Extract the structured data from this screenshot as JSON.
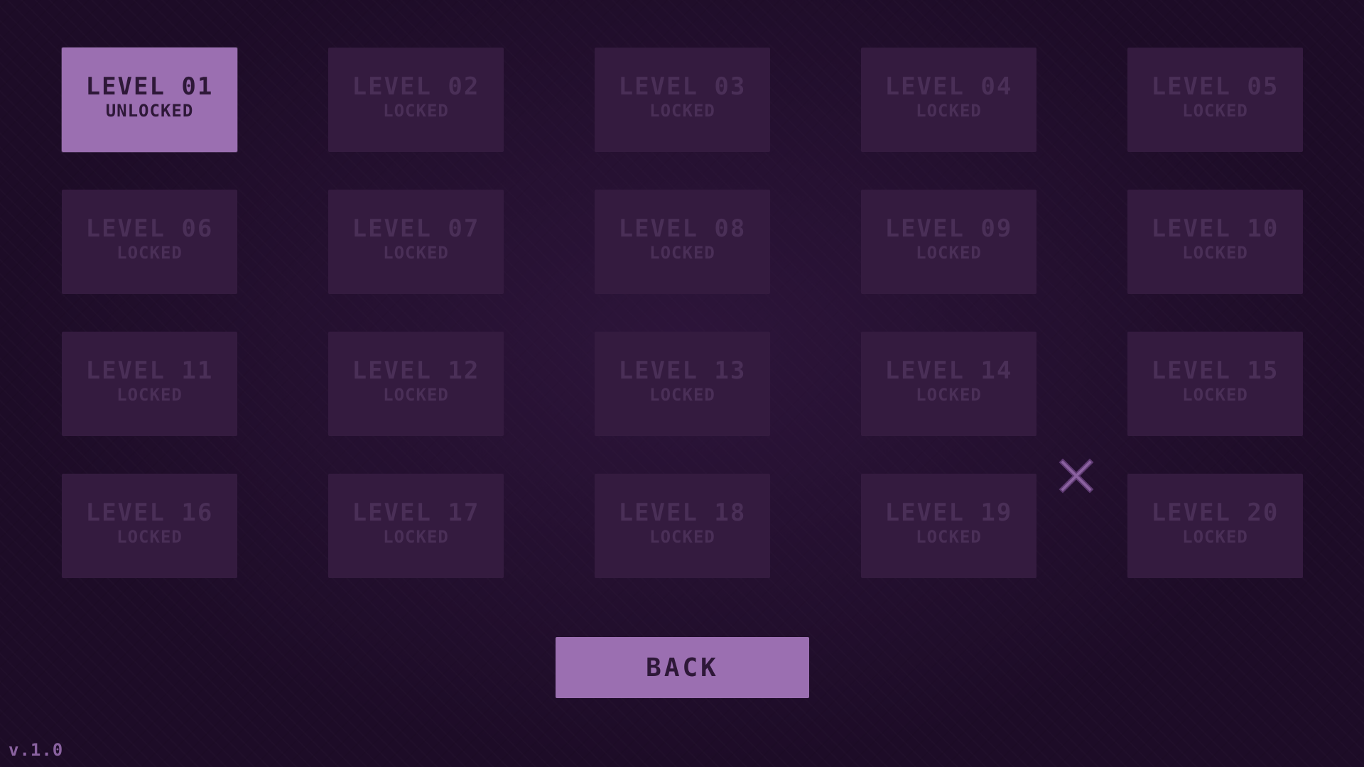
{
  "levels": [
    {
      "title": "LEVEL 01",
      "status": "UNLOCKED",
      "unlocked": true
    },
    {
      "title": "LEVEL 02",
      "status": "LOCKED",
      "unlocked": false
    },
    {
      "title": "LEVEL 03",
      "status": "LOCKED",
      "unlocked": false
    },
    {
      "title": "LEVEL 04",
      "status": "LOCKED",
      "unlocked": false
    },
    {
      "title": "LEVEL 05",
      "status": "LOCKED",
      "unlocked": false
    },
    {
      "title": "LEVEL 06",
      "status": "LOCKED",
      "unlocked": false
    },
    {
      "title": "LEVEL 07",
      "status": "LOCKED",
      "unlocked": false
    },
    {
      "title": "LEVEL 08",
      "status": "LOCKED",
      "unlocked": false
    },
    {
      "title": "LEVEL 09",
      "status": "LOCKED",
      "unlocked": false
    },
    {
      "title": "LEVEL 10",
      "status": "LOCKED",
      "unlocked": false
    },
    {
      "title": "LEVEL 11",
      "status": "LOCKED",
      "unlocked": false
    },
    {
      "title": "LEVEL 12",
      "status": "LOCKED",
      "unlocked": false
    },
    {
      "title": "LEVEL 13",
      "status": "LOCKED",
      "unlocked": false
    },
    {
      "title": "LEVEL 14",
      "status": "LOCKED",
      "unlocked": false
    },
    {
      "title": "LEVEL 15",
      "status": "LOCKED",
      "unlocked": false
    },
    {
      "title": "LEVEL 16",
      "status": "LOCKED",
      "unlocked": false
    },
    {
      "title": "LEVEL 17",
      "status": "LOCKED",
      "unlocked": false
    },
    {
      "title": "LEVEL 18",
      "status": "LOCKED",
      "unlocked": false
    },
    {
      "title": "LEVEL 19",
      "status": "LOCKED",
      "unlocked": false
    },
    {
      "title": "LEVEL 20",
      "status": "LOCKED",
      "unlocked": false
    }
  ],
  "back_button": {
    "label": "BACK"
  },
  "cursor": {
    "icon": "x-cursor-icon"
  },
  "version": "v.1.0",
  "colors": {
    "background": "#1d0c27",
    "tile_locked": "#341b3f",
    "tile_locked_text": "#4a2f57",
    "tile_unlocked": "#9b6fb1",
    "tile_unlocked_text": "#2e1838",
    "version_text": "#8a62a0"
  }
}
